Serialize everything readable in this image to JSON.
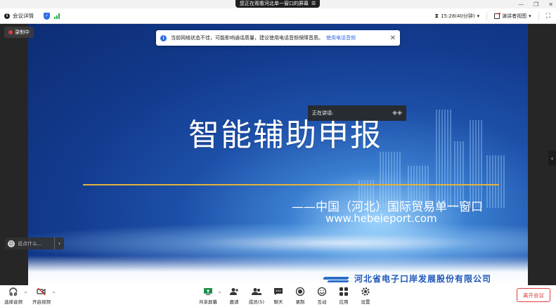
{
  "window": {
    "share_notice": "您正在观看河北单一窗口的屏幕",
    "share_icon": "menu-icon"
  },
  "topbar": {
    "meeting_details": "会议详情",
    "timer": "15:28(40分钟)",
    "view_mode": "演讲者视图"
  },
  "notice": {
    "text": "当前网络状态不佳，可能影响通话质量，建议使用电话音频保障音质。",
    "link": "使用电话音频"
  },
  "speaking": {
    "label": "正在讲话:"
  },
  "recording": {
    "label": "录制中"
  },
  "chat": {
    "placeholder": "说点什么..."
  },
  "slide": {
    "title": "智能辅助申报",
    "subtitle": "——中国（河北）国际贸易单一窗口",
    "url": "www.hebeieport.com",
    "company": "河北省电子口岸发展股份有限公司"
  },
  "toolbar": {
    "items": [
      {
        "label": "选择音频",
        "icon": "headset-icon"
      },
      {
        "label": "开启视频",
        "icon": "video-off-icon"
      },
      {
        "label": "共享屏幕",
        "icon": "share-screen-icon"
      },
      {
        "label": "邀请",
        "icon": "invite-icon"
      },
      {
        "label": "成员(5)",
        "icon": "members-icon"
      },
      {
        "label": "聊天",
        "icon": "chat-icon"
      },
      {
        "label": "录制",
        "icon": "record-icon"
      },
      {
        "label": "互动",
        "icon": "interact-icon"
      },
      {
        "label": "应用",
        "icon": "apps-icon"
      },
      {
        "label": "设置",
        "icon": "settings-icon"
      }
    ],
    "leave": "离开会议"
  },
  "colors": {
    "accent": "#2f6de0",
    "danger": "#e23c3c",
    "gold": "#e3b33b",
    "signal": "#23b14d"
  }
}
